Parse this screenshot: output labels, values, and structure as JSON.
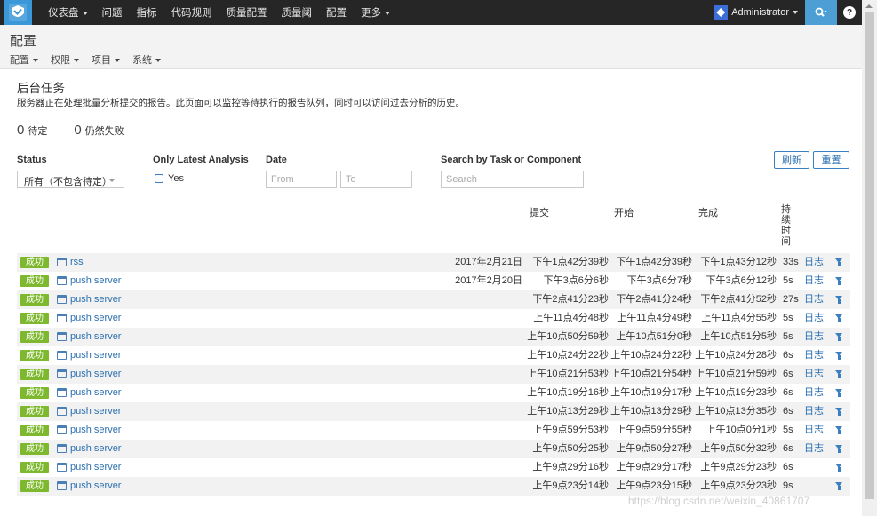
{
  "nav": {
    "items": [
      "仪表盘",
      "问题",
      "指标",
      "代码规则",
      "质量配置",
      "质量阈",
      "配置",
      "更多"
    ],
    "user": "Administrator",
    "help": "?"
  },
  "page": {
    "title": "配置",
    "subnav": [
      "配置",
      "权限",
      "项目",
      "系统"
    ]
  },
  "section": {
    "title": "后台任务",
    "desc": "服务器正在处理批量分析提交的报告。此页面可以监控等待执行的报告队列，同时可以访问过去分析的历史。",
    "pending_count": "0",
    "pending_label": "待定",
    "failing_count": "0",
    "failing_label": "仍然失败"
  },
  "filters": {
    "status_label": "Status",
    "status_value": "所有（不包含待定）",
    "only_latest_label": "Only Latest Analysis",
    "only_latest_checkbox": "Yes",
    "date_label": "Date",
    "date_from_placeholder": "From",
    "date_to_placeholder": "To",
    "search_label": "Search by Task or Component",
    "search_placeholder": "Search",
    "refresh_btn": "刷新",
    "reset_btn": "重置"
  },
  "table": {
    "headers": {
      "submitted": "提交",
      "started": "开始",
      "finished": "完成",
      "duration": "持续时间"
    },
    "rows": [
      {
        "status": "成功",
        "component": "rss",
        "date": "2017年2月21日",
        "submitted": "下午1点42分39秒",
        "started": "下午1点42分39秒",
        "finished": "下午1点43分12秒",
        "duration": "33s",
        "log": "日志"
      },
      {
        "status": "成功",
        "component": "push server",
        "date": "2017年2月20日",
        "submitted": "下午3点6分6秒",
        "started": "下午3点6分7秒",
        "finished": "下午3点6分12秒",
        "duration": "5s",
        "log": "日志"
      },
      {
        "status": "成功",
        "component": "push server",
        "date": "",
        "submitted": "下午2点41分23秒",
        "started": "下午2点41分24秒",
        "finished": "下午2点41分52秒",
        "duration": "27s",
        "log": "日志"
      },
      {
        "status": "成功",
        "component": "push server",
        "date": "",
        "submitted": "上午11点4分48秒",
        "started": "上午11点4分49秒",
        "finished": "上午11点4分55秒",
        "duration": "5s",
        "log": "日志"
      },
      {
        "status": "成功",
        "component": "push server",
        "date": "",
        "submitted": "上午10点50分59秒",
        "started": "上午10点51分0秒",
        "finished": "上午10点51分5秒",
        "duration": "5s",
        "log": "日志"
      },
      {
        "status": "成功",
        "component": "push server",
        "date": "",
        "submitted": "上午10点24分22秒",
        "started": "上午10点24分22秒",
        "finished": "上午10点24分28秒",
        "duration": "6s",
        "log": "日志"
      },
      {
        "status": "成功",
        "component": "push server",
        "date": "",
        "submitted": "上午10点21分53秒",
        "started": "上午10点21分54秒",
        "finished": "上午10点21分59秒",
        "duration": "6s",
        "log": "日志"
      },
      {
        "status": "成功",
        "component": "push server",
        "date": "",
        "submitted": "上午10点19分16秒",
        "started": "上午10点19分17秒",
        "finished": "上午10点19分23秒",
        "duration": "6s",
        "log": "日志"
      },
      {
        "status": "成功",
        "component": "push server",
        "date": "",
        "submitted": "上午10点13分29秒",
        "started": "上午10点13分29秒",
        "finished": "上午10点13分35秒",
        "duration": "6s",
        "log": "日志"
      },
      {
        "status": "成功",
        "component": "push server",
        "date": "",
        "submitted": "上午9点59分53秒",
        "started": "上午9点59分55秒",
        "finished": "上午10点0分1秒",
        "duration": "5s",
        "log": "日志"
      },
      {
        "status": "成功",
        "component": "push server",
        "date": "",
        "submitted": "上午9点50分25秒",
        "started": "上午9点50分27秒",
        "finished": "上午9点50分32秒",
        "duration": "6s",
        "log": "日志"
      },
      {
        "status": "成功",
        "component": "push server",
        "date": "",
        "submitted": "上午9点29分16秒",
        "started": "上午9点29分17秒",
        "finished": "上午9点29分23秒",
        "duration": "6s",
        "log": ""
      },
      {
        "status": "成功",
        "component": "push server",
        "date": "",
        "submitted": "上午9点23分14秒",
        "started": "上午9点23分15秒",
        "finished": "上午9点23分23秒",
        "duration": "9s",
        "log": ""
      }
    ]
  },
  "watermark": "https://blog.csdn.net/weixin_40861707"
}
